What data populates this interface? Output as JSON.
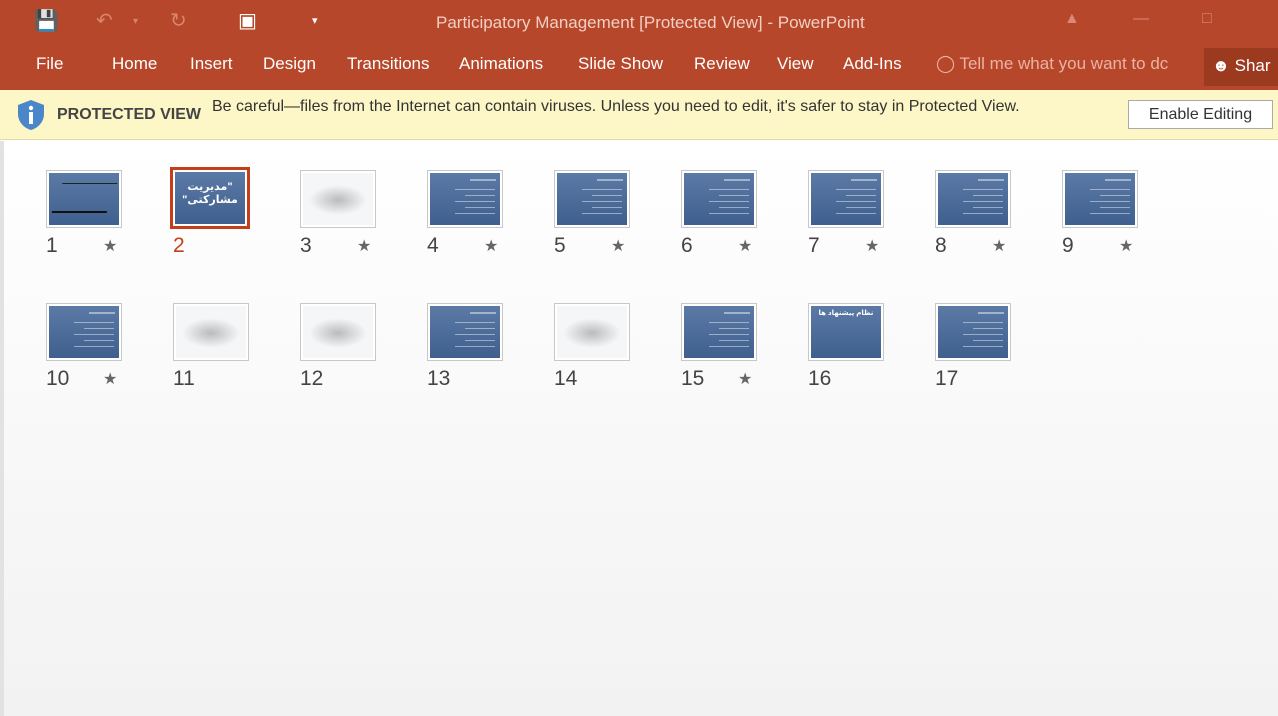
{
  "window": {
    "title": "Participatory Management [Protected View] - PowerPoint",
    "accent": "#B7472A"
  },
  "quick_access": [
    "save-icon",
    "undo-icon",
    "redo-icon",
    "presentation-icon",
    "customize-icon"
  ],
  "tabs": [
    "File",
    "Home",
    "Insert",
    "Design",
    "Transitions",
    "Animations",
    "Slide Show",
    "Review",
    "View",
    "Add-Ins"
  ],
  "tell_me": "Tell me what you want to dc",
  "share": "Shar",
  "protected": {
    "label": "PROTECTED VIEW",
    "message": "Be careful—files from the Internet can contain viruses. Unless you need to edit, it's safer to stay in Protected View.",
    "button": "Enable Editing"
  },
  "slides": [
    {
      "n": "1",
      "star": true,
      "kind": "calligraphy"
    },
    {
      "n": "2",
      "star": false,
      "selected": true,
      "text": "\"مدیریت مشارکتی\""
    },
    {
      "n": "3",
      "star": true,
      "kind": "light"
    },
    {
      "n": "4",
      "star": true
    },
    {
      "n": "5",
      "star": true
    },
    {
      "n": "6",
      "star": true
    },
    {
      "n": "7",
      "star": true
    },
    {
      "n": "8",
      "star": true
    },
    {
      "n": "9",
      "star": true
    },
    {
      "n": "10",
      "star": true
    },
    {
      "n": "11",
      "star": false,
      "kind": "light"
    },
    {
      "n": "12",
      "star": false,
      "kind": "light"
    },
    {
      "n": "13",
      "star": false
    },
    {
      "n": "14",
      "star": false,
      "kind": "light"
    },
    {
      "n": "15",
      "star": true
    },
    {
      "n": "16",
      "star": false,
      "text": "نظام پیشنهاد ها"
    },
    {
      "n": "17",
      "star": false
    }
  ]
}
